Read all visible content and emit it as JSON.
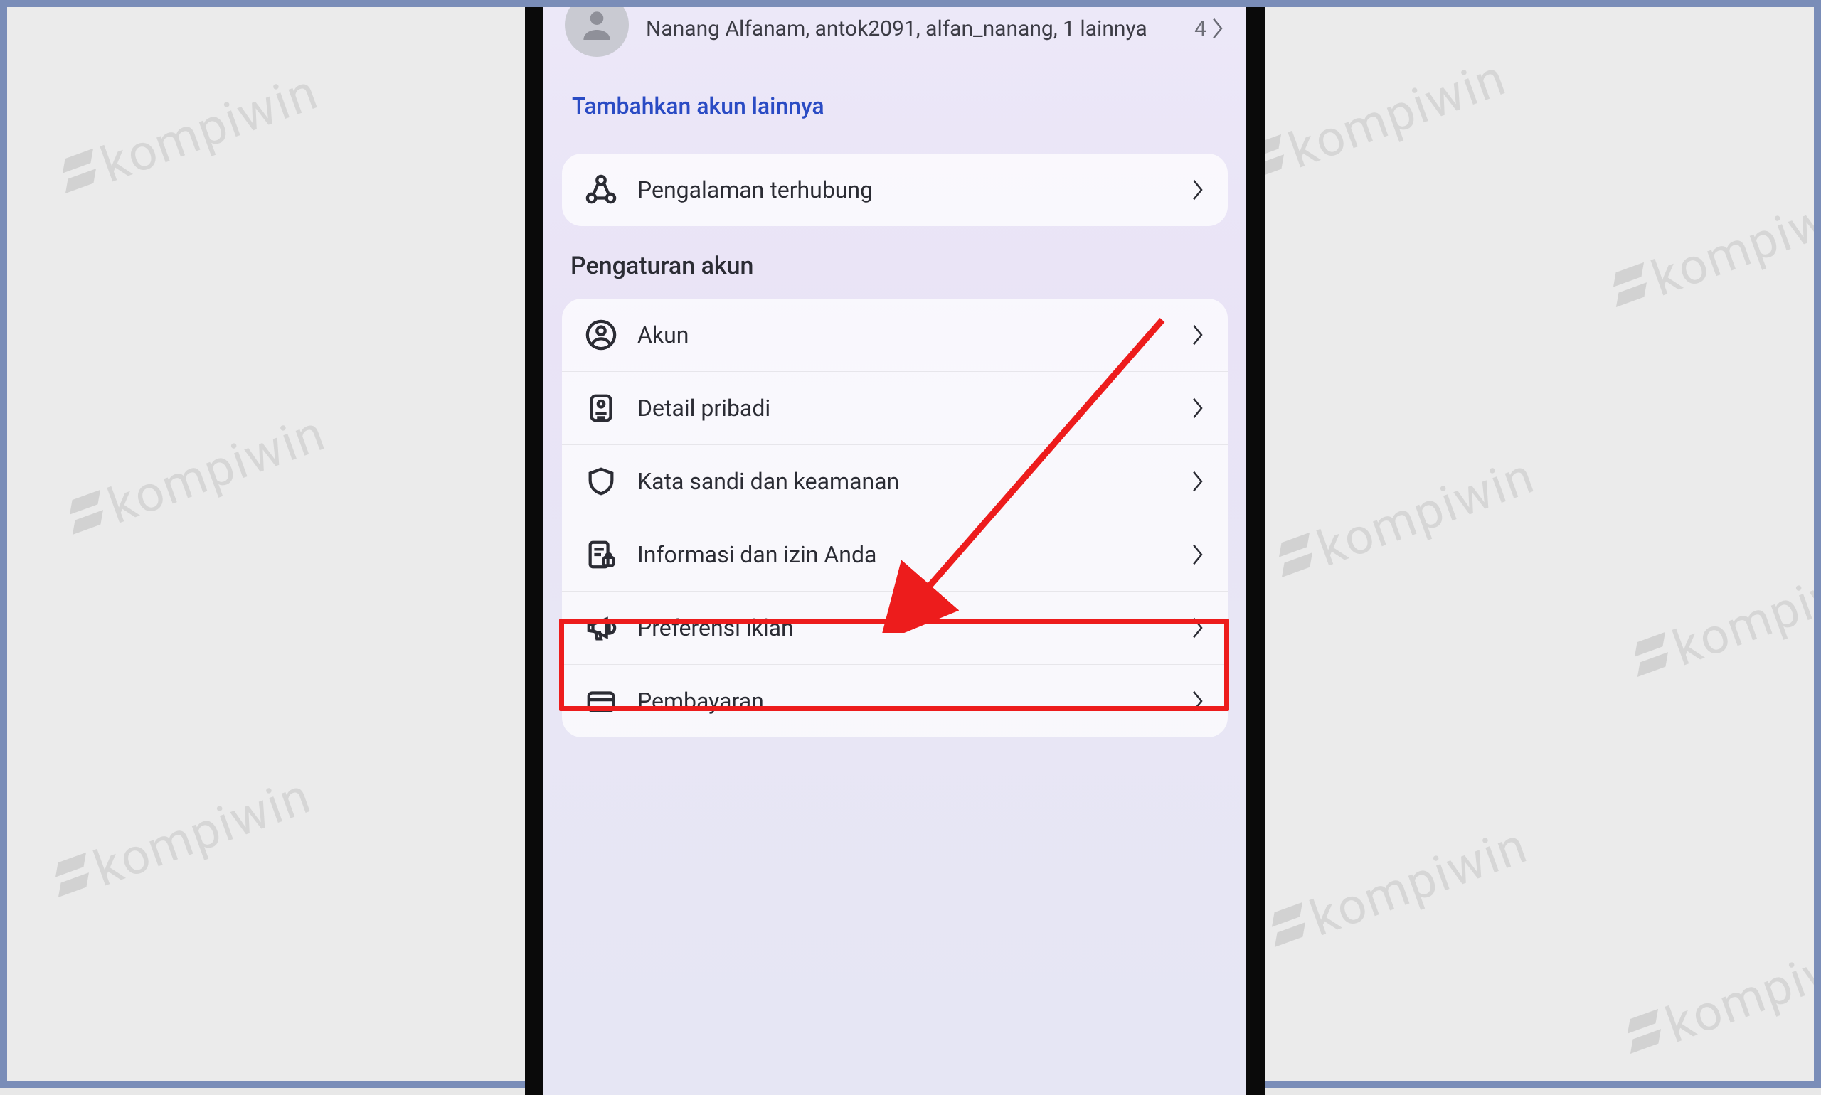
{
  "watermark": "kompiwin",
  "accounts": {
    "names": "Nanang Alfanam, antok2091, alfan_nanang, 1 lainnya",
    "count": "4"
  },
  "add_account_label": "Tambahkan akun lainnya",
  "connected": {
    "label": "Pengalaman terhubung"
  },
  "section_title": "Pengaturan akun",
  "settings": {
    "account": "Akun",
    "personal": "Detail pribadi",
    "security": "Kata sandi dan keamanan",
    "info": "Informasi dan izin Anda",
    "ads": "Preferensi iklan",
    "payments": "Pembayaran"
  }
}
